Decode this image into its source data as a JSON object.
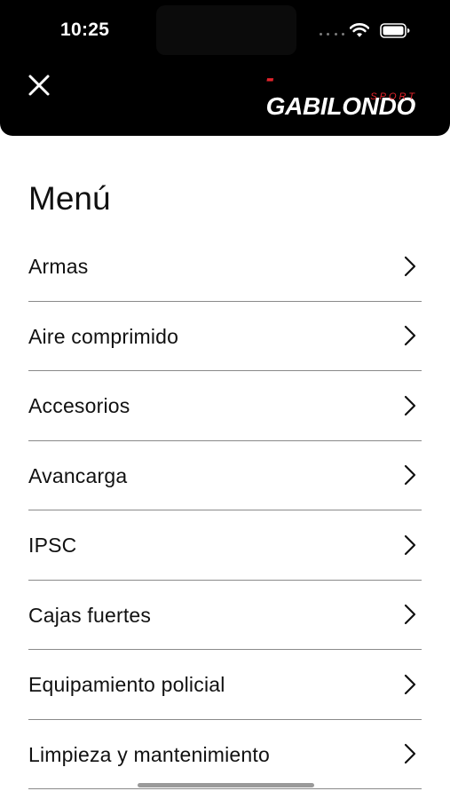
{
  "status_bar": {
    "time": "10:25",
    "wifi_icon": "wifi-icon",
    "battery_icon": "battery-icon"
  },
  "header": {
    "close_icon": "close-icon",
    "brand": {
      "name": "GABILONDO",
      "tagline": "SPORT",
      "accent_color": "#e3232b"
    },
    "background_color": "#000000"
  },
  "menu": {
    "title": "Menú",
    "chevron_icon": "chevron-right-icon",
    "items": [
      {
        "label": "Armas"
      },
      {
        "label": "Aire comprimido"
      },
      {
        "label": "Accesorios"
      },
      {
        "label": "Avancarga"
      },
      {
        "label": "IPSC"
      },
      {
        "label": "Cajas fuertes"
      },
      {
        "label": "Equipamiento policial"
      },
      {
        "label": "Limpieza y mantenimiento"
      }
    ]
  }
}
